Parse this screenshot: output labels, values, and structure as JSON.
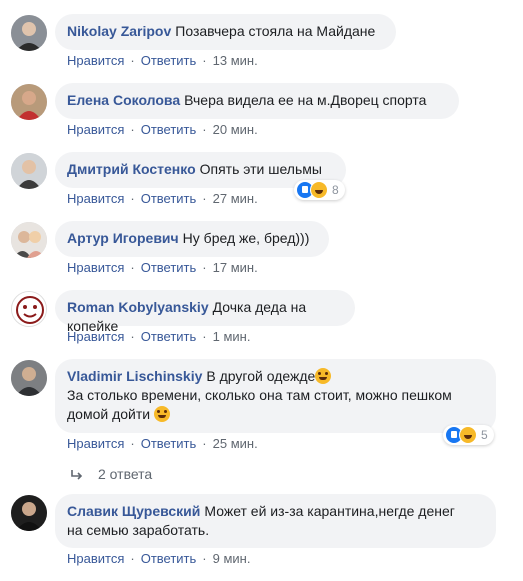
{
  "comments": [
    {
      "author": "Nikolay Zaripov",
      "text": "Позавчера стояла на Майдане",
      "like": "Нравится",
      "reply": "Ответить",
      "time": "13 мин."
    },
    {
      "author": "Елена Соколова",
      "text": "Вчера видела ее на м.Дворец спорта",
      "like": "Нравится",
      "reply": "Ответить",
      "time": "20 мин."
    },
    {
      "author": "Дмитрий Костенко",
      "text": "Опять эти шельмы",
      "like": "Нравится",
      "reply": "Ответить",
      "time": "27 мин.",
      "reactions": "8"
    },
    {
      "author": "Артур Игоревич",
      "text": "Ну бред же, бред)))",
      "like": "Нравится",
      "reply": "Ответить",
      "time": "17 мин."
    },
    {
      "author": "Roman Kobylyanskiy",
      "text": "Дочка деда на копейке",
      "like": "Нравится",
      "reply": "Ответить",
      "time": "1 мин."
    },
    {
      "author": "Vladimir Lischinskiy",
      "text": "В другой одежде",
      "text2": "За столько времени, сколько она там стоит, можно пешком",
      "text3": "домой дойти",
      "like": "Нравится",
      "reply": "Ответить",
      "time": "25 мин.",
      "reactions": "5"
    },
    {
      "author": "Славик Щуревский",
      "text": "Может ей из-за карантина,негде денег",
      "text2": "на семью заработать.",
      "like": "Нравится",
      "reply": "Ответить",
      "time": "9 мин."
    }
  ],
  "replies_label": "2 ответа",
  "colors": {
    "link": "#385898",
    "bubble": "#f2f3f5",
    "meta": "#606770"
  },
  "icons": [
    "like-reaction-icon",
    "haha-reaction-icon",
    "reply-arrow-icon",
    "grinning-emoji-icon"
  ]
}
